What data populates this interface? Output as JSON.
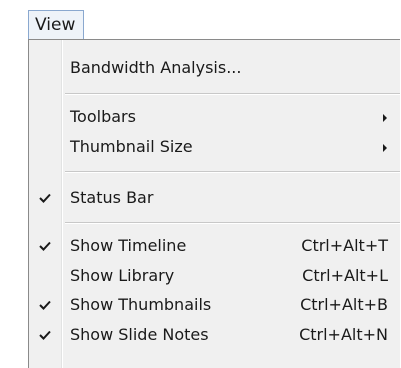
{
  "menubar": {
    "active_menu": "View"
  },
  "menu": {
    "items": [
      {
        "label": "Bandwidth Analysis...",
        "checked": false,
        "shortcut": "",
        "submenu": false
      },
      {
        "label": "Toolbars",
        "checked": false,
        "shortcut": "",
        "submenu": true
      },
      {
        "label": "Thumbnail Size",
        "checked": false,
        "shortcut": "",
        "submenu": true
      },
      {
        "label": "Status Bar",
        "checked": true,
        "shortcut": "",
        "submenu": false
      },
      {
        "label": "Show Timeline",
        "checked": true,
        "shortcut": "Ctrl+Alt+T",
        "submenu": false
      },
      {
        "label": "Show Library",
        "checked": false,
        "shortcut": "Ctrl+Alt+L",
        "submenu": false
      },
      {
        "label": "Show Thumbnails",
        "checked": true,
        "shortcut": "Ctrl+Alt+B",
        "submenu": false
      },
      {
        "label": "Show Slide Notes",
        "checked": true,
        "shortcut": "Ctrl+Alt+N",
        "submenu": false
      }
    ]
  },
  "colors": {
    "menu_background": "#f0f0f0",
    "menubar_highlight": "#eef3f9",
    "menubar_border": "#8aa8cf",
    "separator": "#c8c8c8"
  },
  "icons": {
    "check": "check-icon",
    "submenu_arrow": "chevron-right-icon"
  }
}
